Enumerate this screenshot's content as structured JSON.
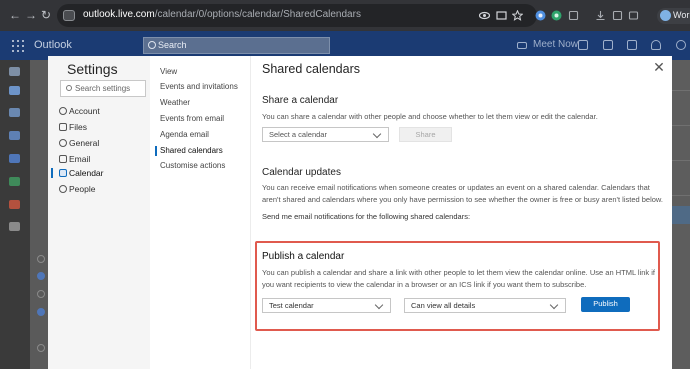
{
  "browser": {
    "url_host": "outlook.live.com",
    "url_path": "/calendar/0/options/calendar/SharedCalendars",
    "profile_label": "Work"
  },
  "outlook": {
    "app_title": "Outlook",
    "search_placeholder": "Search",
    "meet_now_label": "Meet Now"
  },
  "settings": {
    "title": "Settings",
    "search_placeholder": "Search settings",
    "nav": [
      {
        "label": "Account",
        "icon": "person-icon"
      },
      {
        "label": "Files",
        "icon": "file-icon"
      },
      {
        "label": "General",
        "icon": "gear-icon"
      },
      {
        "label": "Email",
        "icon": "mail-icon"
      },
      {
        "label": "Calendar",
        "icon": "calendar-icon",
        "selected": true
      },
      {
        "label": "People",
        "icon": "people-icon"
      }
    ],
    "subnav": [
      {
        "label": "View"
      },
      {
        "label": "Events and invitations"
      },
      {
        "label": "Weather"
      },
      {
        "label": "Events from email"
      },
      {
        "label": "Agenda email"
      },
      {
        "label": "Shared calendars",
        "selected": true
      },
      {
        "label": "Customise actions"
      }
    ]
  },
  "main": {
    "title": "Shared calendars",
    "share": {
      "heading": "Share a calendar",
      "description": "You can share a calendar with other people and choose whether to let them view or edit the calendar.",
      "select_placeholder": "Select a calendar",
      "share_button": "Share"
    },
    "updates": {
      "heading": "Calendar updates",
      "description": "You can receive email notifications when someone creates or updates an event on a shared calendar. Calendars that aren't shared and calendars where you only have permission to see whether the owner is free or busy aren't listed below.",
      "notify_label": "Send me email notifications for the following shared calendars:"
    },
    "publish": {
      "heading": "Publish a calendar",
      "description": "You can publish a calendar and share a link with other people to let them view the calendar online. Use an HTML link if you want recipients to view the calendar in a browser or an ICS link if you want them to subscribe.",
      "calendar_value": "Test calendar",
      "permission_value": "Can view all details",
      "publish_button": "Publish"
    }
  },
  "colors": {
    "accent": "#0f6cbd",
    "highlight_border": "#e05a4e",
    "outlook_header": "#1b3b73"
  }
}
